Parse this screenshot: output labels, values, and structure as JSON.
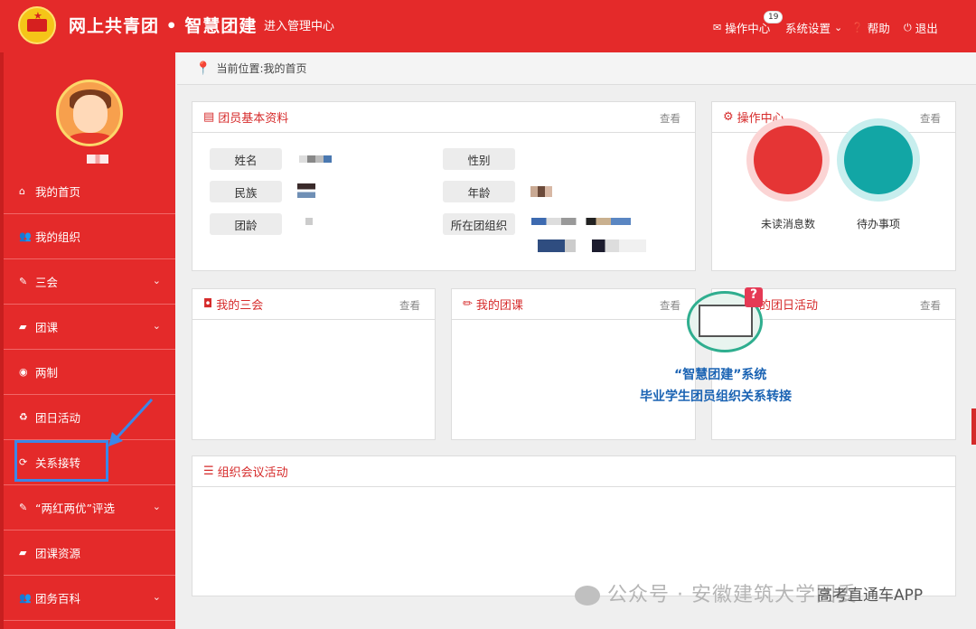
{
  "header": {
    "brand": "网上共青团 • 智慧团建",
    "admin_link": "进入管理中心",
    "ops_center": "操作中心",
    "ops_badge": "19",
    "settings": "系统设置",
    "help": "帮助",
    "logout": "退出"
  },
  "sidebar": {
    "items": [
      {
        "label": "我的首页",
        "icon": "home-icon"
      },
      {
        "label": "我的组织",
        "icon": "users-icon"
      },
      {
        "label": "三会",
        "icon": "edit-icon"
      },
      {
        "label": "团课",
        "icon": "folder-icon"
      },
      {
        "label": "两制",
        "icon": "target-icon"
      },
      {
        "label": "团日活动",
        "icon": "recycle-icon"
      },
      {
        "label": "关系接转",
        "icon": "refresh-icon"
      },
      {
        "label": "“两红两优”评选",
        "icon": "edit-icon"
      },
      {
        "label": "团课资源",
        "icon": "folder-icon"
      },
      {
        "label": "团务百科",
        "icon": "users-icon"
      }
    ]
  },
  "breadcrumb": "当前位置:我的首页",
  "profile": {
    "title": "团员基本资料",
    "more": "查看",
    "labels": {
      "name": "姓名",
      "gender": "性别",
      "ethnicity": "民族",
      "age": "年龄",
      "league_age": "团龄",
      "org": "所在团组织"
    }
  },
  "ops": {
    "title": "操作中心",
    "more": "查看",
    "unread": "未读消息数",
    "todo": "待办事项"
  },
  "sanhui": {
    "title": "我的三会",
    "more": "查看"
  },
  "tuanke": {
    "title": "我的团课",
    "more": "查看"
  },
  "tuanri": {
    "title": "的团日活动",
    "more": "查看"
  },
  "meeting": {
    "title": "组织会议活动"
  },
  "overlay": {
    "line1": "“智慧团建”系统",
    "line2": "毕业学生团员组织关系转接"
  },
  "watermark": "公众号 · 安徽建筑大学团委",
  "watermark2": "高考直通车APP",
  "colors": {
    "primary": "#e42a2a",
    "accent_blue": "#3b87e8",
    "teal": "#12a6a5"
  }
}
